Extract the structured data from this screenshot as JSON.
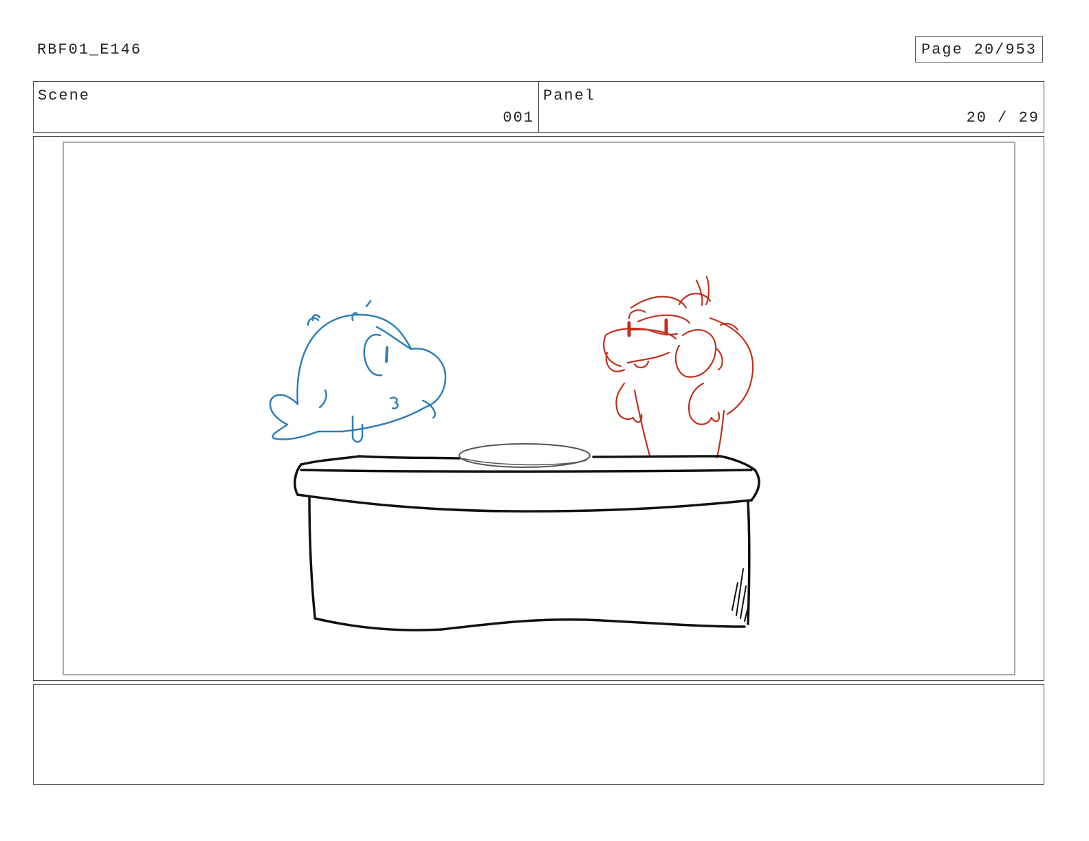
{
  "header": {
    "episode_code": "RBF01_E146",
    "page_label": "Page",
    "page_value": "20/953"
  },
  "info": {
    "scene_label": "Scene",
    "scene_value": "001",
    "panel_label": "Panel",
    "panel_value": "20 / 29"
  },
  "drawing": {
    "colors": {
      "blue_character": "#2e7fb5",
      "red_character": "#c0301c",
      "counter": "#111111",
      "plate": "#555555"
    }
  },
  "notes": {
    "text": ""
  }
}
